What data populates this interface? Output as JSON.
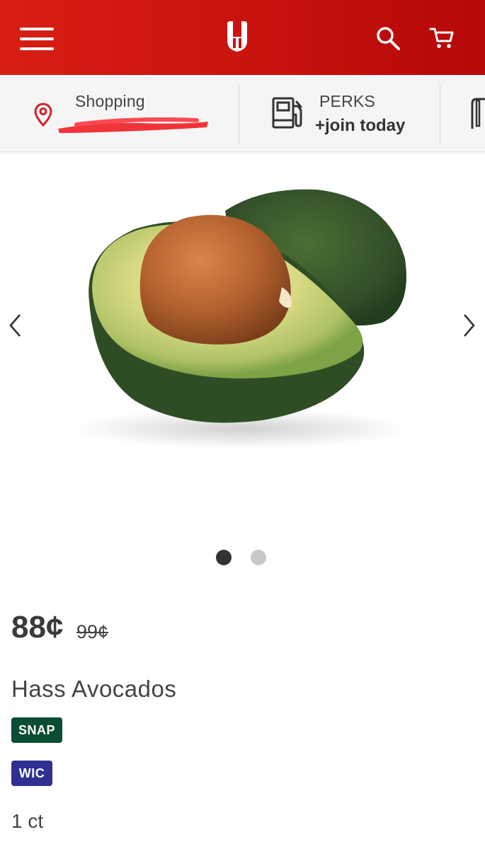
{
  "header": {
    "menu_icon": "hamburger-menu-icon",
    "logo": "store-logo",
    "search_icon": "search-icon",
    "cart_icon": "cart-icon",
    "brand_color": "#d71e14"
  },
  "info_bar": {
    "shopping": {
      "icon": "location-pin-icon",
      "label": "Shopping",
      "value_redacted": true
    },
    "perks": {
      "icon": "fuel-pump-icon",
      "label": "PERKS",
      "action": "+join today"
    },
    "next_icon": "partial-logo-icon"
  },
  "carousel": {
    "image_alt": "Hass avocado cut in half with pit",
    "prev_icon": "chevron-left-icon",
    "next_icon": "chevron-right-icon",
    "slide_count": 2,
    "active_slide": 1
  },
  "product": {
    "price": "88¢",
    "original_price": "99¢",
    "name": "Hass Avocados",
    "badges": [
      {
        "label": "SNAP",
        "color": "#0b4d33"
      },
      {
        "label": "WIC",
        "color": "#2e3192"
      }
    ],
    "quantity": "1 ct"
  }
}
